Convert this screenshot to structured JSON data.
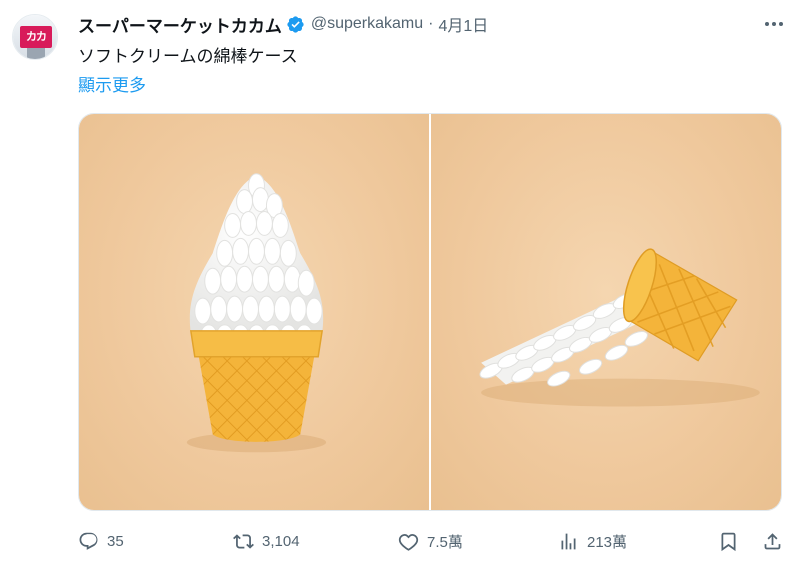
{
  "author": {
    "name": "スーパーマーケットカカム",
    "handle": "@superkakamu",
    "date": "4月1日",
    "avatar_text": "カカ"
  },
  "tweet": {
    "text": "ソフトクリームの綿棒ケース",
    "show_more": "顯示更多"
  },
  "media": [
    {
      "desc_icon": "photo-upright-cone"
    },
    {
      "desc_icon": "photo-tipped-cone"
    }
  ],
  "actions": {
    "replies": "35",
    "retweets": "3,104",
    "likes": "7.5萬",
    "views": "213萬"
  },
  "colors": {
    "accent": "#1d9bf0",
    "secondary_text": "#536471",
    "cone": "#f4b43a",
    "background_photo": "#efc89c"
  }
}
